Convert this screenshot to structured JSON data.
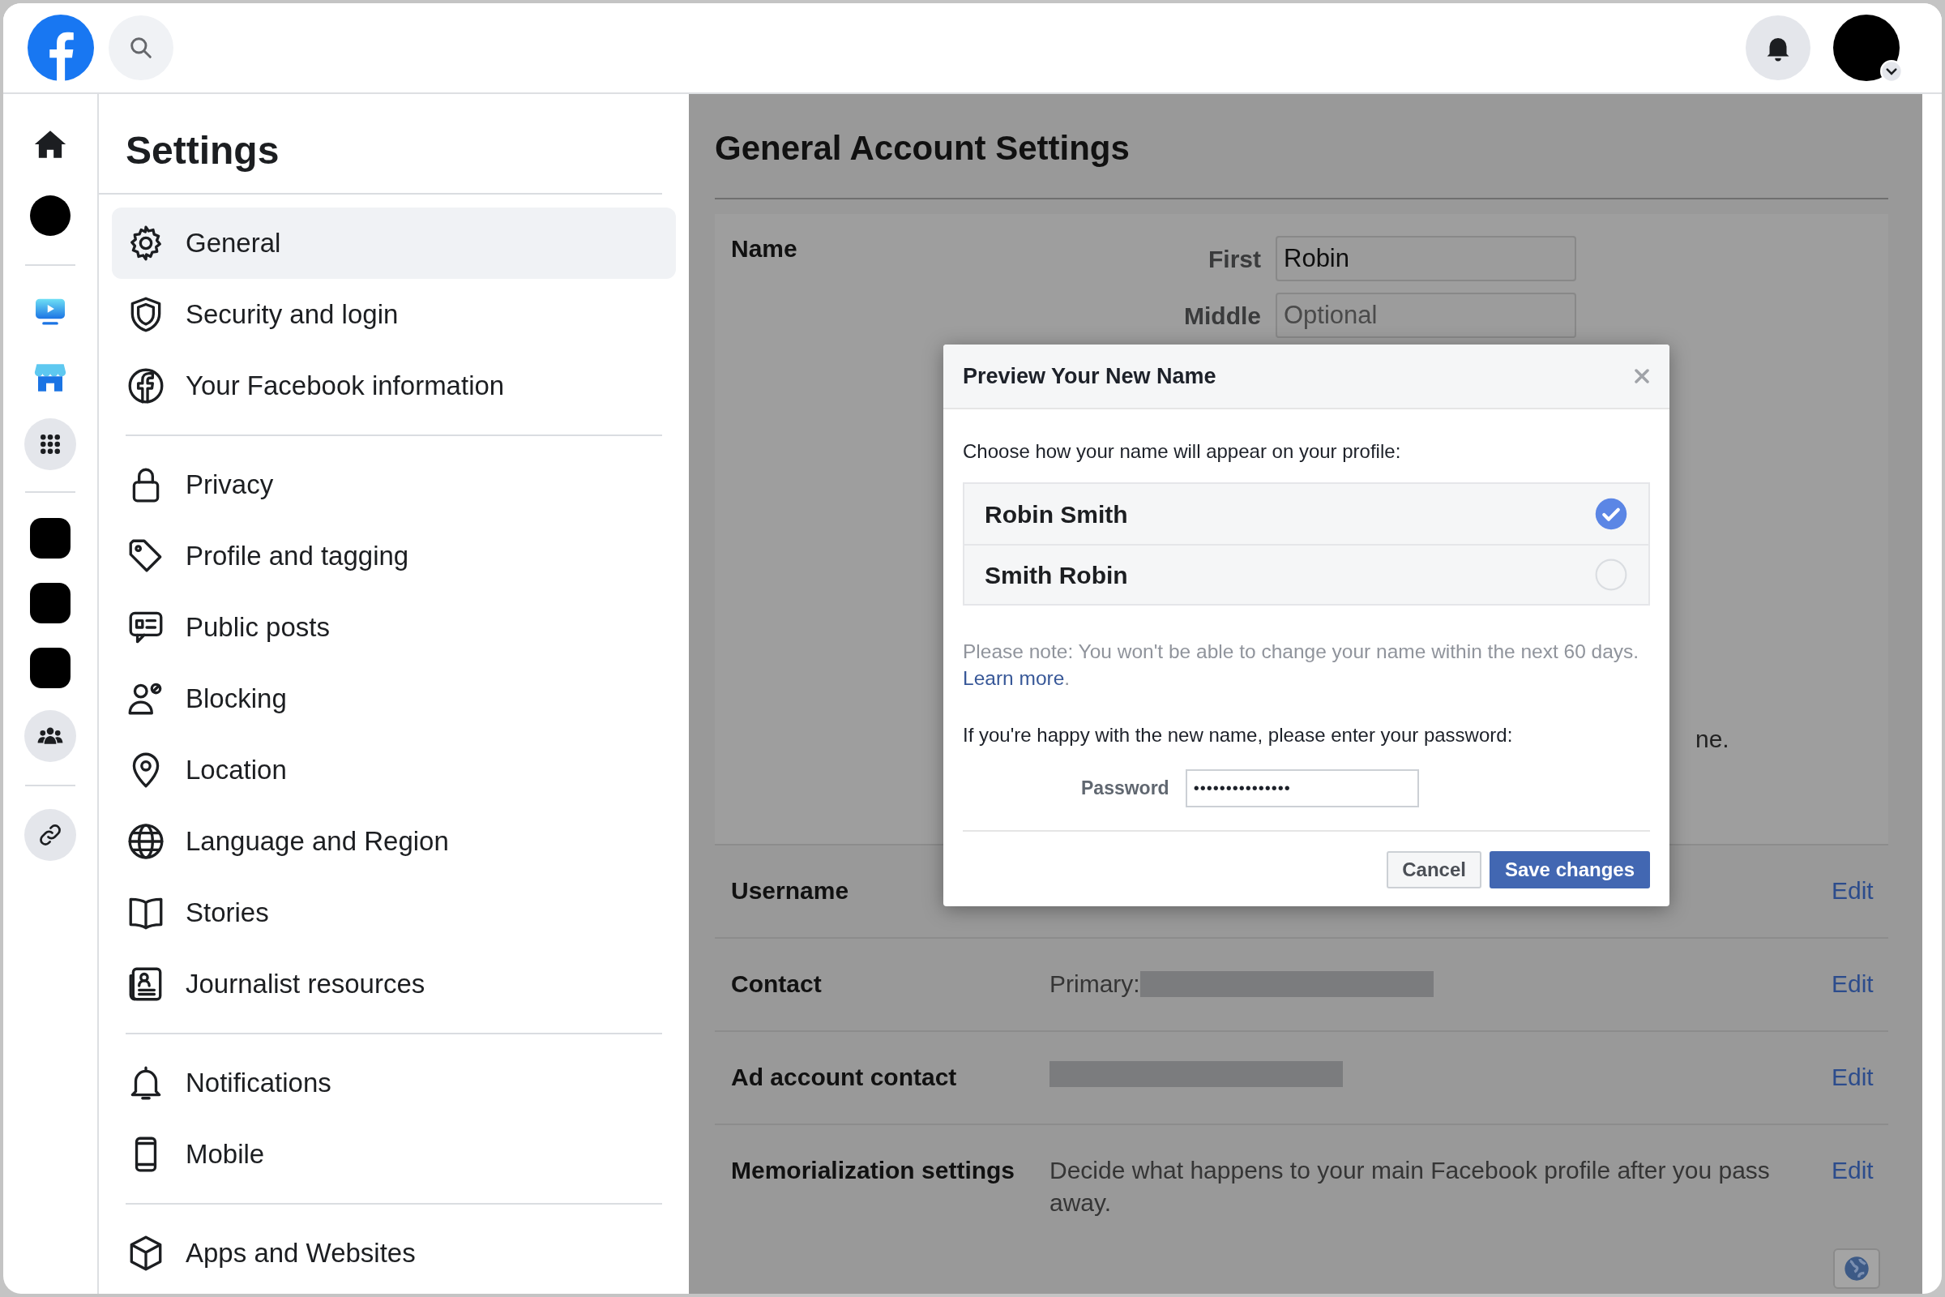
{
  "sidebar": {
    "title": "Settings",
    "groups": [
      {
        "items": [
          {
            "label": "General",
            "selected": true
          },
          {
            "label": "Security and login",
            "selected": false
          },
          {
            "label": "Your Facebook information",
            "selected": false
          }
        ]
      },
      {
        "items": [
          {
            "label": "Privacy",
            "selected": false
          },
          {
            "label": "Profile and tagging",
            "selected": false
          },
          {
            "label": "Public posts",
            "selected": false
          },
          {
            "label": "Blocking",
            "selected": false
          },
          {
            "label": "Location",
            "selected": false
          },
          {
            "label": "Language and Region",
            "selected": false
          },
          {
            "label": "Stories",
            "selected": false
          },
          {
            "label": "Journalist resources",
            "selected": false
          }
        ]
      },
      {
        "items": [
          {
            "label": "Notifications",
            "selected": false
          },
          {
            "label": "Mobile",
            "selected": false
          }
        ]
      },
      {
        "items": [
          {
            "label": "Apps and Websites",
            "selected": false
          }
        ]
      }
    ]
  },
  "content": {
    "title": "General Account Settings",
    "name_section": {
      "label": "Name",
      "fields": [
        {
          "label": "First",
          "value": "Robin"
        },
        {
          "label": "Middle",
          "placeholder": "Optional"
        }
      ],
      "partial_text": "ne."
    },
    "rows": [
      {
        "label": "Username",
        "edit": "Edit"
      },
      {
        "label": "Contact",
        "value": "Primary:",
        "redacted": true,
        "edit": "Edit"
      },
      {
        "label": "Ad account contact",
        "redacted": true,
        "edit": "Edit"
      },
      {
        "label": "Memorialization settings",
        "value": "Decide what happens to your main Facebook profile after you pass away.",
        "edit": "Edit"
      }
    ]
  },
  "dialog": {
    "title": "Preview Your New Name",
    "prompt": "Choose how your name will appear on your profile:",
    "options": [
      {
        "label": "Robin Smith",
        "selected": true
      },
      {
        "label": "Smith Robin",
        "selected": false
      }
    ],
    "note": "Please note: You won't be able to change your name within the next 60 days.",
    "link": "Learn more",
    "note_end": ".",
    "password_prompt": "If you're happy with the new name, please enter your password:",
    "password": {
      "label": "Password",
      "value": "•••••••••••••••"
    },
    "buttons": [
      {
        "label": "Cancel",
        "kind": "secondary"
      },
      {
        "label": "Save changes",
        "kind": "primary"
      }
    ]
  }
}
